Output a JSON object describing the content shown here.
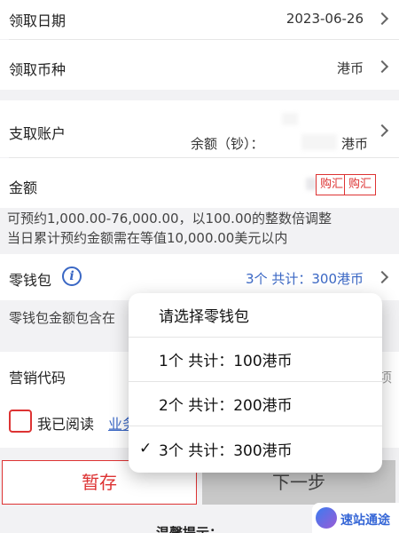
{
  "pickup_date": {
    "label": "领取日期",
    "value": "2023-06-26"
  },
  "currency": {
    "label": "领取币种",
    "value": "港币"
  },
  "account": {
    "label": "支取账户",
    "balance_label": "余额（钞）：",
    "balance_suffix": "港币"
  },
  "amount": {
    "label": "金额",
    "tag1": "购汇",
    "tag2": "购汇"
  },
  "notes": [
    "可预约1,000.00-76,000.00，以100.00的整数倍调整",
    "当日累计预约金额需在等值10,000.00美元以内"
  ],
  "wallet": {
    "label": "零钱包",
    "value": "3个  共计：300港币"
  },
  "wallet_note": "零钱包金额包含在",
  "marketing": {
    "label": "营销代码",
    "tail": "项"
  },
  "agree": {
    "text": "我已阅读",
    "link": "业务"
  },
  "buttons": {
    "save": "暂存",
    "next": "下一步"
  },
  "bottom_hint": "温馨提示：",
  "popup": {
    "title": "请选择零钱包",
    "options": [
      {
        "label": "1个  共计：100港币",
        "selected": false
      },
      {
        "label": "2个  共计：200港币",
        "selected": false
      },
      {
        "label": "3个  共计：300港币",
        "selected": true
      }
    ],
    "check_mark": "✓"
  },
  "logo": {
    "text": "速站通途"
  },
  "colors": {
    "accent_red": "#d33333",
    "link_blue": "#3a67c4",
    "disabled_gray": "#c8c8c8"
  }
}
